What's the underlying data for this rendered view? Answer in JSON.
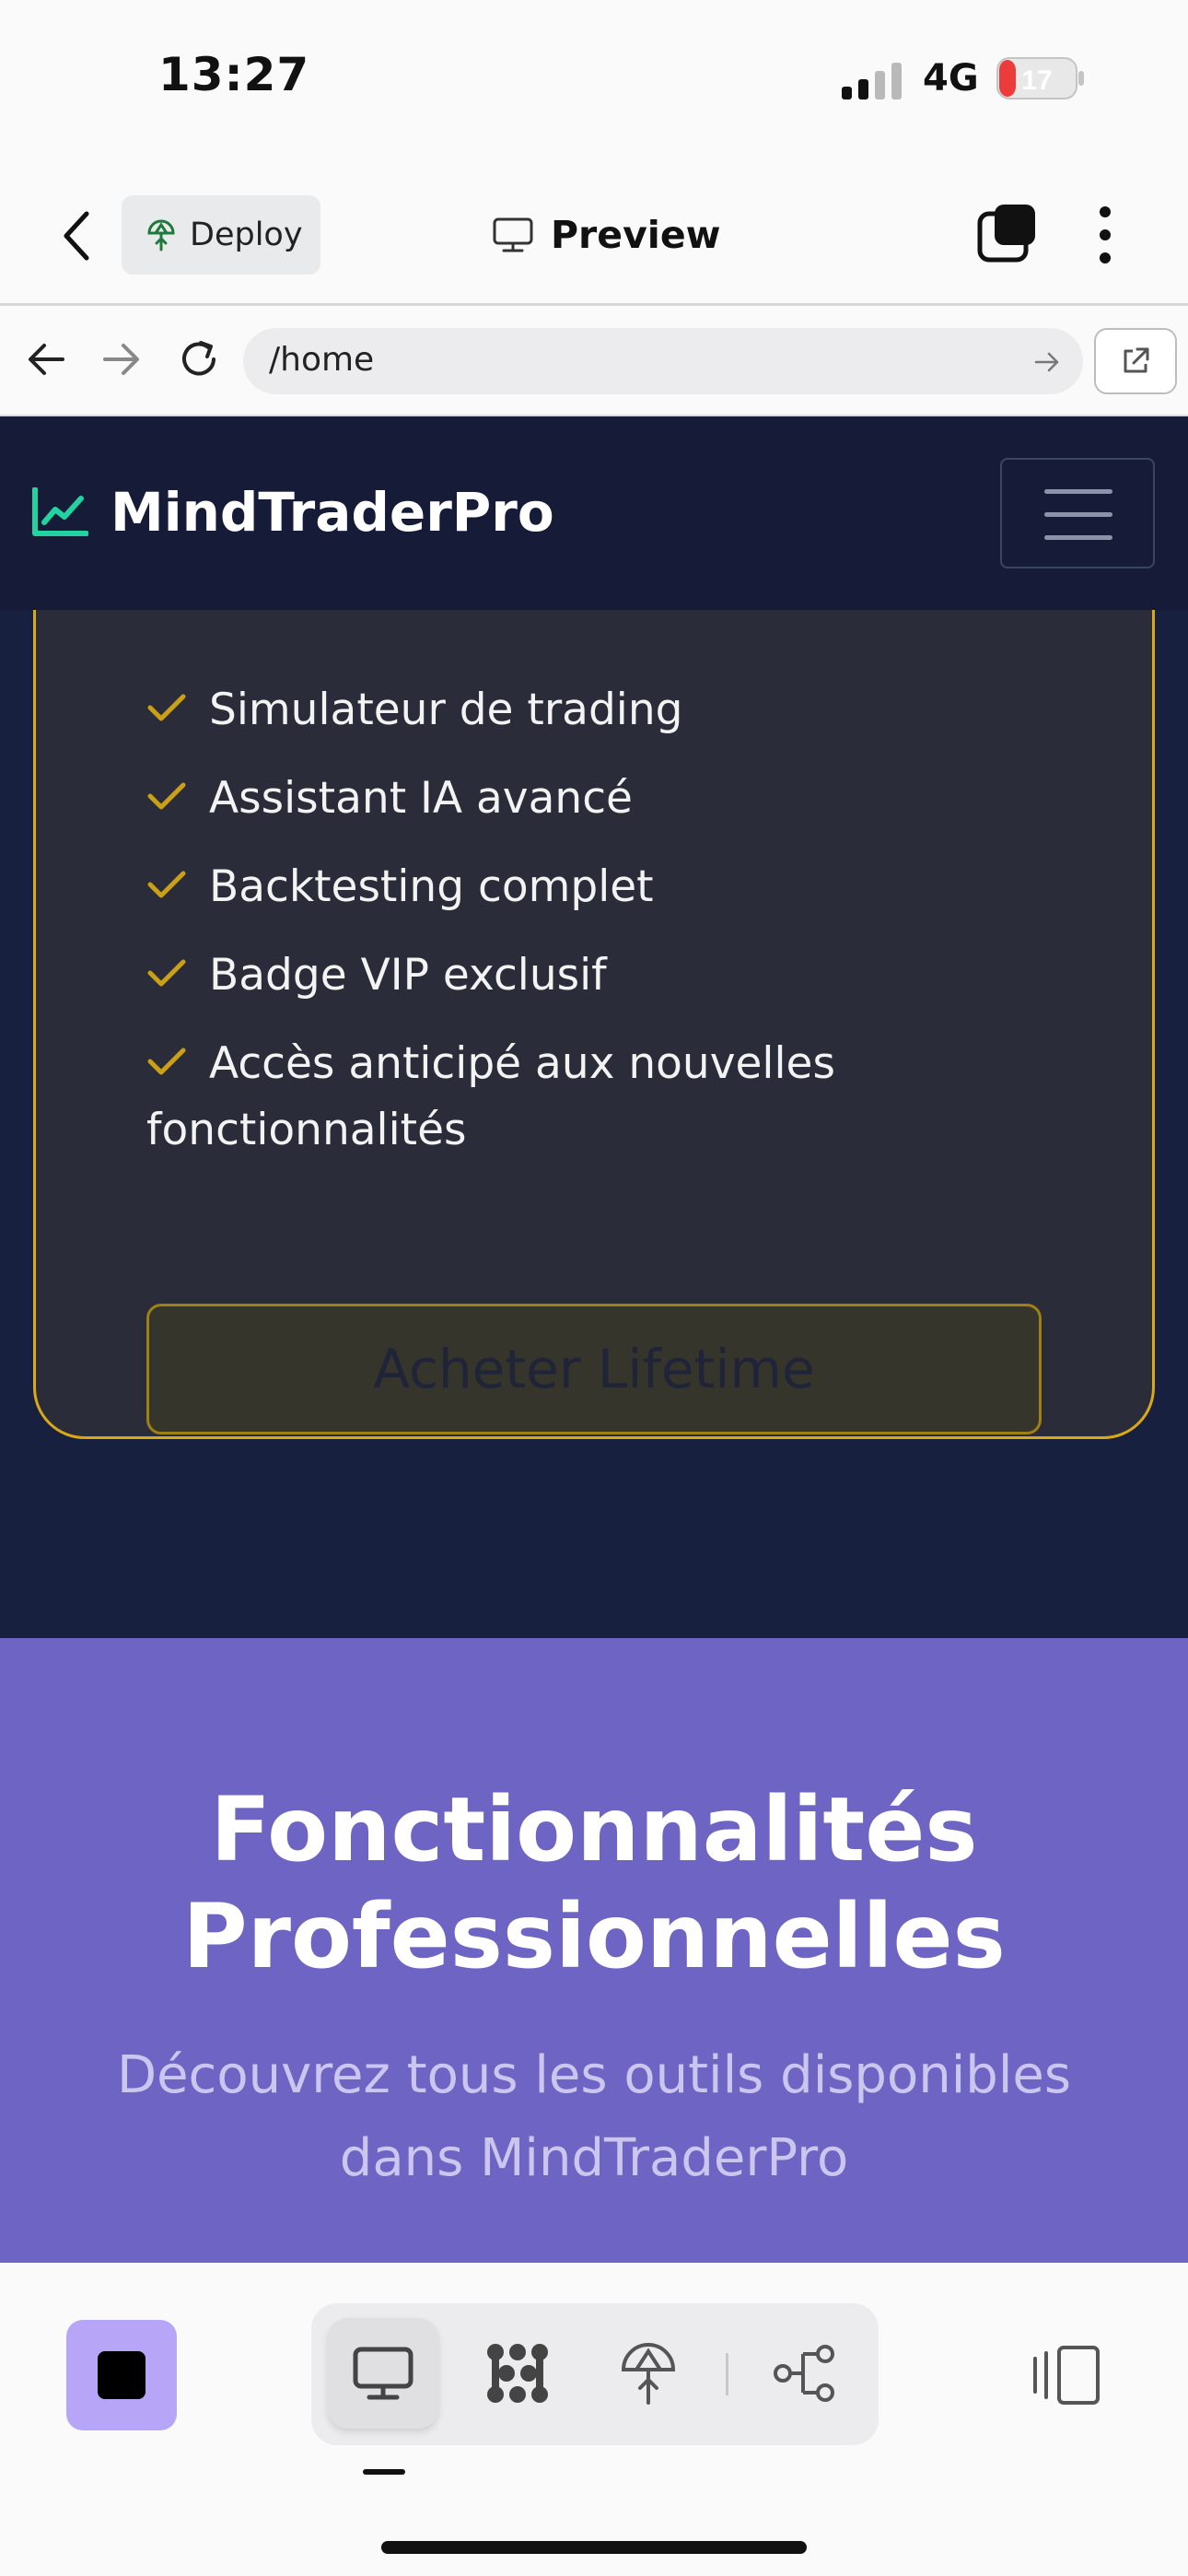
{
  "status_bar": {
    "time": "13:27",
    "network": "4G",
    "battery": "17"
  },
  "app_toolbar": {
    "deploy_label": "Deploy",
    "preview_label": "Preview"
  },
  "browser": {
    "url": "/home"
  },
  "site": {
    "brand": "MindTraderPro",
    "pricing_card": {
      "features": [
        "Simulateur de trading",
        "Assistant IA avancé",
        "Backtesting complet",
        "Badge VIP exclusif",
        "Accès anticipé aux nouvelles fonctionnalités"
      ],
      "cta": "Acheter Lifetime"
    },
    "features_section": {
      "title": "Fonctionnalités Professionnelles",
      "subtitle": "Découvrez tous les outils disponibles dans MindTraderPro"
    }
  },
  "colors": {
    "accent_gold": "#d8a817",
    "brand_green": "#22d3a0",
    "features_bg": "#6e64c4",
    "stop_button": "#b7a6f8"
  }
}
